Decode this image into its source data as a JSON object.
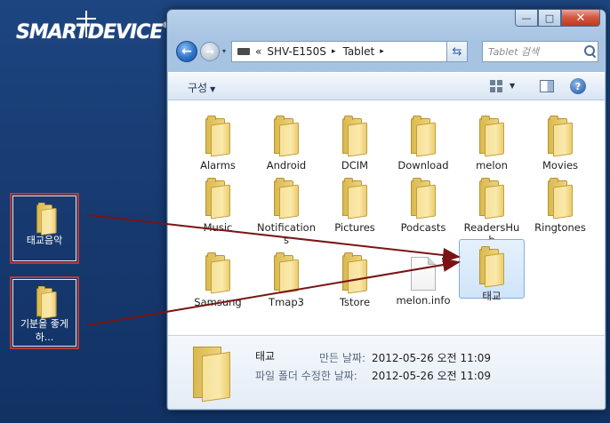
{
  "brand": {
    "logo_text": "SMARTDEVICE",
    "logo_mark": "®"
  },
  "desktop": {
    "items": [
      {
        "label": "태교음악"
      },
      {
        "label": "기분을 좋게하..."
      }
    ]
  },
  "window": {
    "caption": {
      "minimize": "—",
      "maximize": "□",
      "close": "✕"
    },
    "nav": {
      "back": "←",
      "forward": "→",
      "history": "▾",
      "address_prefix": "«",
      "address_segments": [
        "SHV-E150S",
        "Tablet"
      ],
      "address_sep": "▸",
      "address_dropdown": "▾",
      "refresh": "⇆",
      "search_placeholder": "Tablet 검색"
    },
    "toolbar": {
      "organize_label": "구성",
      "organize_caret": "▼",
      "view_caret": "▼",
      "help": "?"
    },
    "files": [
      {
        "name": "Alarms",
        "type": "folder"
      },
      {
        "name": "Android",
        "type": "folder"
      },
      {
        "name": "DCIM",
        "type": "folder"
      },
      {
        "name": "Download",
        "type": "folder"
      },
      {
        "name": "melon",
        "type": "folder"
      },
      {
        "name": "Movies",
        "type": "folder"
      },
      {
        "name": "Music",
        "type": "folder"
      },
      {
        "name": "Notifications",
        "type": "folder"
      },
      {
        "name": "Pictures",
        "type": "folder"
      },
      {
        "name": "Podcasts",
        "type": "folder"
      },
      {
        "name": "ReadersHub",
        "type": "folder"
      },
      {
        "name": "Ringtones",
        "type": "folder"
      },
      {
        "name": "Samsung",
        "type": "folder"
      },
      {
        "name": "Tmap3",
        "type": "folder"
      },
      {
        "name": "Tstore",
        "type": "folder"
      },
      {
        "name": "melon.info",
        "type": "file"
      },
      {
        "name": "태교",
        "type": "folder",
        "selected": true
      }
    ],
    "details": {
      "name": "태교",
      "created_label": "만든 날짜:",
      "created_value": "2012-05-26 오전 11:09",
      "modified_label": "파일 폴더 수정한 날짜:",
      "modified_value": "2012-05-26 오전 11:09"
    }
  },
  "colors": {
    "desktop_bg": "#1d4580",
    "annotation_red": "#b33a3a",
    "arrow": "#7a1414",
    "selection": "#cfe4fa"
  }
}
